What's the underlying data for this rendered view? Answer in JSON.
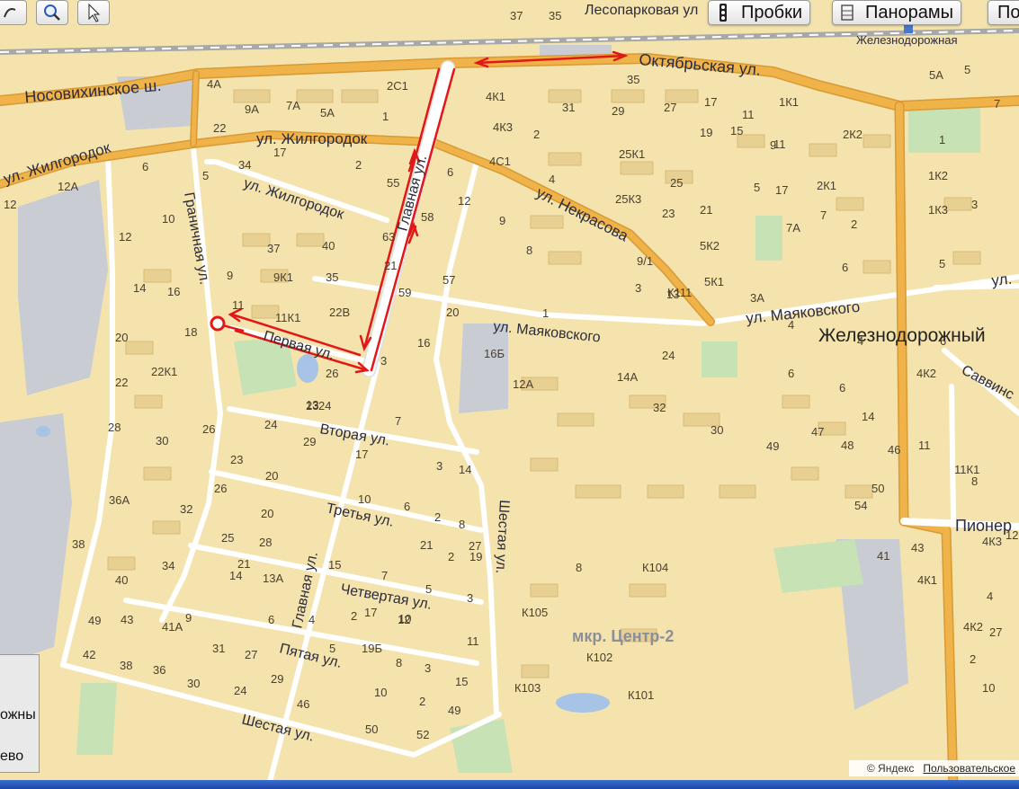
{
  "toolbar": {
    "traffic_label": "Пробки",
    "panoramas_label": "Панорамы",
    "next_label": "По"
  },
  "colors": {
    "background": "#f4e3ad",
    "arterial": "#f0b34a",
    "street": "#ffffff",
    "route": "#e01818",
    "rail": "#a8a8a8",
    "water": "#a7c4e6",
    "industrial": "#c9ccd2",
    "park": "#c7e3b6"
  },
  "streets": {
    "nosovikhinskoe": "Носовихинское ш.",
    "oktyabrskaya": "Октябрьская ул.",
    "zhilgorodok_1": "ул. Жилгородок",
    "zhilgorodok_2": "ул. Жилгородок",
    "zhilgorodok_3": "ул. Жилгородок",
    "glavnaya_1": "Главная ул.",
    "glavnaya_2": "Главная ул.",
    "nekrasova": "ул. Некрасова",
    "mayakovskogo_1": "ул. Маяковского",
    "mayakovskogo_2": "ул. Маяковского",
    "mayakovskogo_3": "ул.",
    "granichnaya": "Граничная ул.",
    "pervaya": "Первая ул.",
    "vtoraya": "Вторая ул.",
    "tretya": "Третья ул.",
    "chetvertaya": "Четвертая ул.",
    "pyataya": "Пятая ул.",
    "shestaya_1": "Шестая ул.",
    "shestaya_2": "Шестая ул.",
    "lesoparkovaya": "Лесопарковая ул",
    "savvinskaya": "Саввинс",
    "pioner": "Пионер"
  },
  "places": {
    "town": "Железнодорожный",
    "station": "Железнодорожная",
    "district": "мкр. Центр-2"
  },
  "minimap": {
    "line1": "ожны",
    "line2": "ево"
  },
  "footer": {
    "copyright": "© Яндекс",
    "terms": "Пользовательское"
  },
  "house_numbers": [
    "37",
    "35",
    "4А",
    "2С1",
    "9А",
    "7А",
    "5А",
    "1",
    "4К1",
    "4К3",
    "2",
    "31",
    "29",
    "27",
    "17",
    "11",
    "1К1",
    "35",
    "5А",
    "5",
    "22",
    "17",
    "34",
    "6",
    "12А",
    "12",
    "5",
    "2",
    "4С1",
    "4",
    "25К1",
    "25К3",
    "19",
    "9",
    "15",
    "17",
    "2К2",
    "1",
    "1К2",
    "1К3",
    "3",
    "6",
    "5",
    "2К1",
    "25",
    "23",
    "21",
    "7А",
    "5К2",
    "5К1",
    "3А",
    "4",
    "6",
    "10",
    "12",
    "16",
    "14",
    "20",
    "18",
    "22К1",
    "28",
    "30",
    "26",
    "22",
    "36А",
    "32",
    "38",
    "34",
    "40",
    "49",
    "43",
    "41А",
    "42",
    "38",
    "36",
    "30",
    "24",
    "31",
    "27",
    "29",
    "9",
    "11",
    "37",
    "40",
    "9К1",
    "35",
    "11К1",
    "22В",
    "26",
    "23",
    "20",
    "16",
    "16Б",
    "12А",
    "14А",
    "24",
    "32",
    "30",
    "49",
    "47",
    "46",
    "48",
    "50",
    "54",
    "41",
    "43",
    "4К1",
    "4К3",
    "4",
    "4К2",
    "2",
    "27",
    "12",
    "10",
    "7",
    "4К2",
    "6",
    "14",
    "11",
    "11К1",
    "13",
    "17",
    "7",
    "3",
    "14",
    "10",
    "6",
    "2",
    "8",
    "15",
    "7",
    "5",
    "3",
    "17",
    "10",
    "2",
    "21",
    "19",
    "26",
    "20",
    "25",
    "28",
    "14",
    "13А",
    "9",
    "6",
    "4",
    "2",
    "12",
    "8",
    "3",
    "15",
    "11",
    "5",
    "19Б",
    "10",
    "2",
    "49",
    "46",
    "50",
    "52",
    "55",
    "58",
    "63",
    "21",
    "59",
    "57",
    "9",
    "8",
    "12",
    "6",
    "3",
    "24",
    "29",
    "27",
    "24",
    "20",
    "23",
    "21",
    "8",
    "К104",
    "К105",
    "К102",
    "К103",
    "К101",
    "К111",
    "1",
    "11",
    "13",
    "9/1",
    "3",
    "5",
    "7",
    "2",
    "4",
    "6",
    "8",
    "10",
    "14"
  ]
}
